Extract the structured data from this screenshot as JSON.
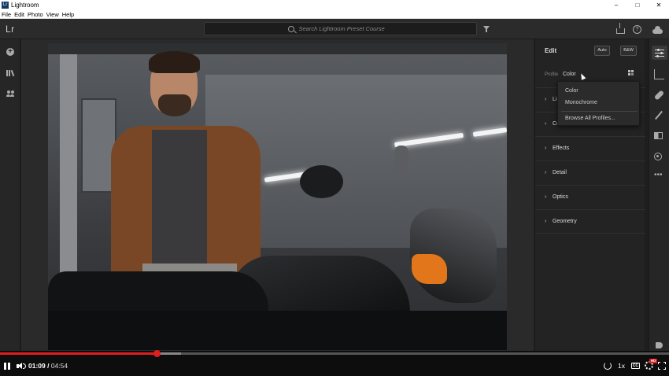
{
  "window": {
    "title": "Lightroom",
    "app_icon": "Lr",
    "controls": {
      "minimize": "–",
      "maximize": "□",
      "close": "✕"
    }
  },
  "menubar": {
    "items": [
      "File",
      "Edit",
      "Photo",
      "View",
      "Help"
    ]
  },
  "appbar": {
    "logo": "Lr",
    "search_placeholder": "Search Lightroom Preset Course",
    "help_glyph": "?"
  },
  "leftrail": {
    "add_glyph": "+"
  },
  "edit_panel": {
    "title": "Edit",
    "auto_label": "Auto",
    "bw_label": "B&W",
    "profile_label": "Profile",
    "profile_value": "Color",
    "profile_caret": "⌄",
    "sections": [
      {
        "label": "Light",
        "chevron": "›"
      },
      {
        "label": "Color",
        "chevron": "›"
      },
      {
        "label": "Effects",
        "chevron": "›"
      },
      {
        "label": "Detail",
        "chevron": "›"
      },
      {
        "label": "Optics",
        "chevron": "›"
      },
      {
        "label": "Geometry",
        "chevron": "›"
      }
    ]
  },
  "profile_dropdown": {
    "options": [
      "Color",
      "Monochrome"
    ],
    "browse_all": "Browse All Profiles..."
  },
  "rightrail": {
    "more_glyph": "•••"
  },
  "player": {
    "current_time": "01:09",
    "separator": " / ",
    "total_time": "04:54",
    "playback_speed": "1x",
    "cc_label": "CC",
    "hd_badge": "HD",
    "progress_fraction": 0.235,
    "buffer_fraction": 0.27,
    "accent_color": "#e01e1e"
  },
  "colors": {
    "panel_bg": "#232323",
    "appbar_bg": "#2b2b2b",
    "canvas_bg": "#2a2a2a"
  }
}
